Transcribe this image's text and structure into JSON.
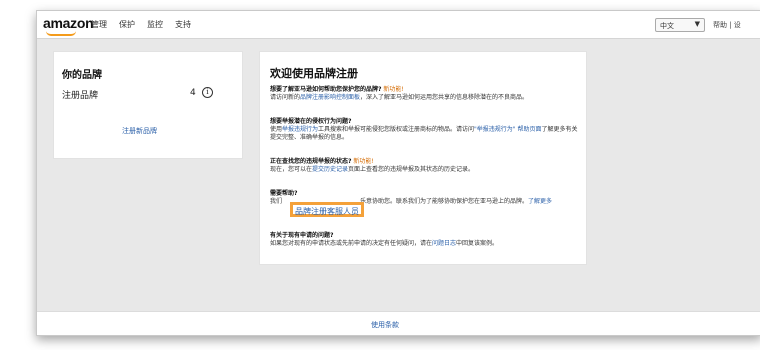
{
  "header": {
    "logo": "amazon",
    "nav": [
      "管理",
      "保护",
      "监控",
      "支持"
    ],
    "language_selected": "中文",
    "right_text": "帮助 | 设"
  },
  "brands_card": {
    "title": "你的品牌",
    "registered_label": "注册品牌",
    "registered_count": "4",
    "register_link": "注册新品牌"
  },
  "welcome_card": {
    "title": "欢迎使用品牌注册",
    "sections": [
      {
        "question": "想要了解亚马逊如何帮助您保护您的品牌?",
        "new_tag": "新功能!",
        "body_prefix": "请访问新的",
        "link": "品牌注册影响控制面板",
        "body_suffix": "，深入了解亚马逊如何运用您共享的信息移除潜在的不良商品。"
      },
      {
        "question": "想要举报潜在的侵权行为问题?",
        "body_prefix": "使用",
        "link": "举报违规行为",
        "body_mid": "工具搜索和举报可能侵犯您版权或注册商标的物品。请访问",
        "link2": "\"举报违规行为\" 帮助页面",
        "body_suffix": "了解更多有关提交完整、准确举报的信息。"
      },
      {
        "question": "正在查找您的违规举报的状态?",
        "new_tag": "新功能!",
        "body_prefix": "现在，您可以在",
        "link": "提交历史记录",
        "body_suffix": "页面上查看您的违规举报及其状态的历史记录。"
      },
      {
        "question": "需要帮助?",
        "body_prefix": "我们",
        "body_mid": "乐意协助您。联系我们为了能够协助保护您在亚马逊上的品牌。",
        "link": "了解更多"
      },
      {
        "question": "有关于现有申请的问题?",
        "body_prefix": "如果您对现有的申请状态或先前申请的决定有任何疑问，请在",
        "link": "问题日志",
        "body_suffix": "中回复该案例。"
      }
    ],
    "highlight_link": "品牌注册客服人员"
  },
  "footer": {
    "link": "使用条款"
  },
  "colors": {
    "link": "#2a5fa8",
    "highlight_border": "#f4a13a",
    "new_tag": "#d46a00"
  }
}
